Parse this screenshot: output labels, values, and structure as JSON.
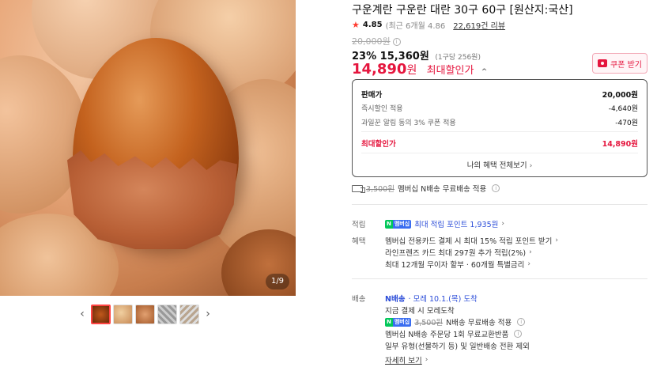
{
  "gallery": {
    "counter": "1/9",
    "prev_icon": "chevron-left-icon",
    "next_icon": "chevron-right-icon",
    "thumbnail_count": 5
  },
  "product": {
    "title": "구운계란 구운란 대란 30구 60구 [원산지:국산]",
    "rating": "4.85",
    "rating_recent": "(최근 6개월 4.86",
    "reviews": "22,619건 리뷰",
    "original_price": "20,000원",
    "discount_pct": "23%",
    "sale_price": "15,360원",
    "unit_price": "(1구당 256원)",
    "best_price": "14,890",
    "best_price_won": "원",
    "best_price_label": "최대할인가",
    "coupon_button": "쿠폰 받기"
  },
  "breakdown": {
    "rows": [
      {
        "label": "판매가",
        "value": "20,000원"
      },
      {
        "label": "즉시할인 적용",
        "value": "-4,640원"
      },
      {
        "label": "과일꾼 알림 동의 3% 쿠폰 적용",
        "value": "-470원"
      }
    ],
    "total_label": "최대할인가",
    "total_value": "14,890원",
    "benefits_link": "나의 혜택 전체보기"
  },
  "shipping_banner": {
    "strike": "3,500원",
    "text": "멤버십 N배송 무료배송 적용"
  },
  "points": {
    "label": "적립",
    "badge_n": "N",
    "badge_p": "멤버십",
    "text": "최대 적립 포인트 1,935원"
  },
  "benefits": {
    "label": "혜택",
    "items": [
      "멤버십 전용카드 결제 시 최대 15% 적립 포인트 받기",
      "라인프렌즈 카드 최대 297원 추가 적립(2%)",
      "최대 12개월 무이자 할부 · 60개월 특별금리"
    ]
  },
  "delivery": {
    "label": "배송",
    "brand": "N배송",
    "arrival": "· 모레 10.1.(목) 도착",
    "line2": "지금 결제 시 모레도착",
    "line3_strike": "3,500원",
    "line3": "N배송 무료배송 적용",
    "line4": "멤버십 N배송 주문당 1회 무료교환반품",
    "line5": "일부 유형(선물하기 등) 및 일반배송 전환 제외",
    "more": "자세히 보기"
  },
  "colors": {
    "accent_red": "#e5163e",
    "npay_green": "#03c75a",
    "link_blue": "#2b4cd8"
  }
}
